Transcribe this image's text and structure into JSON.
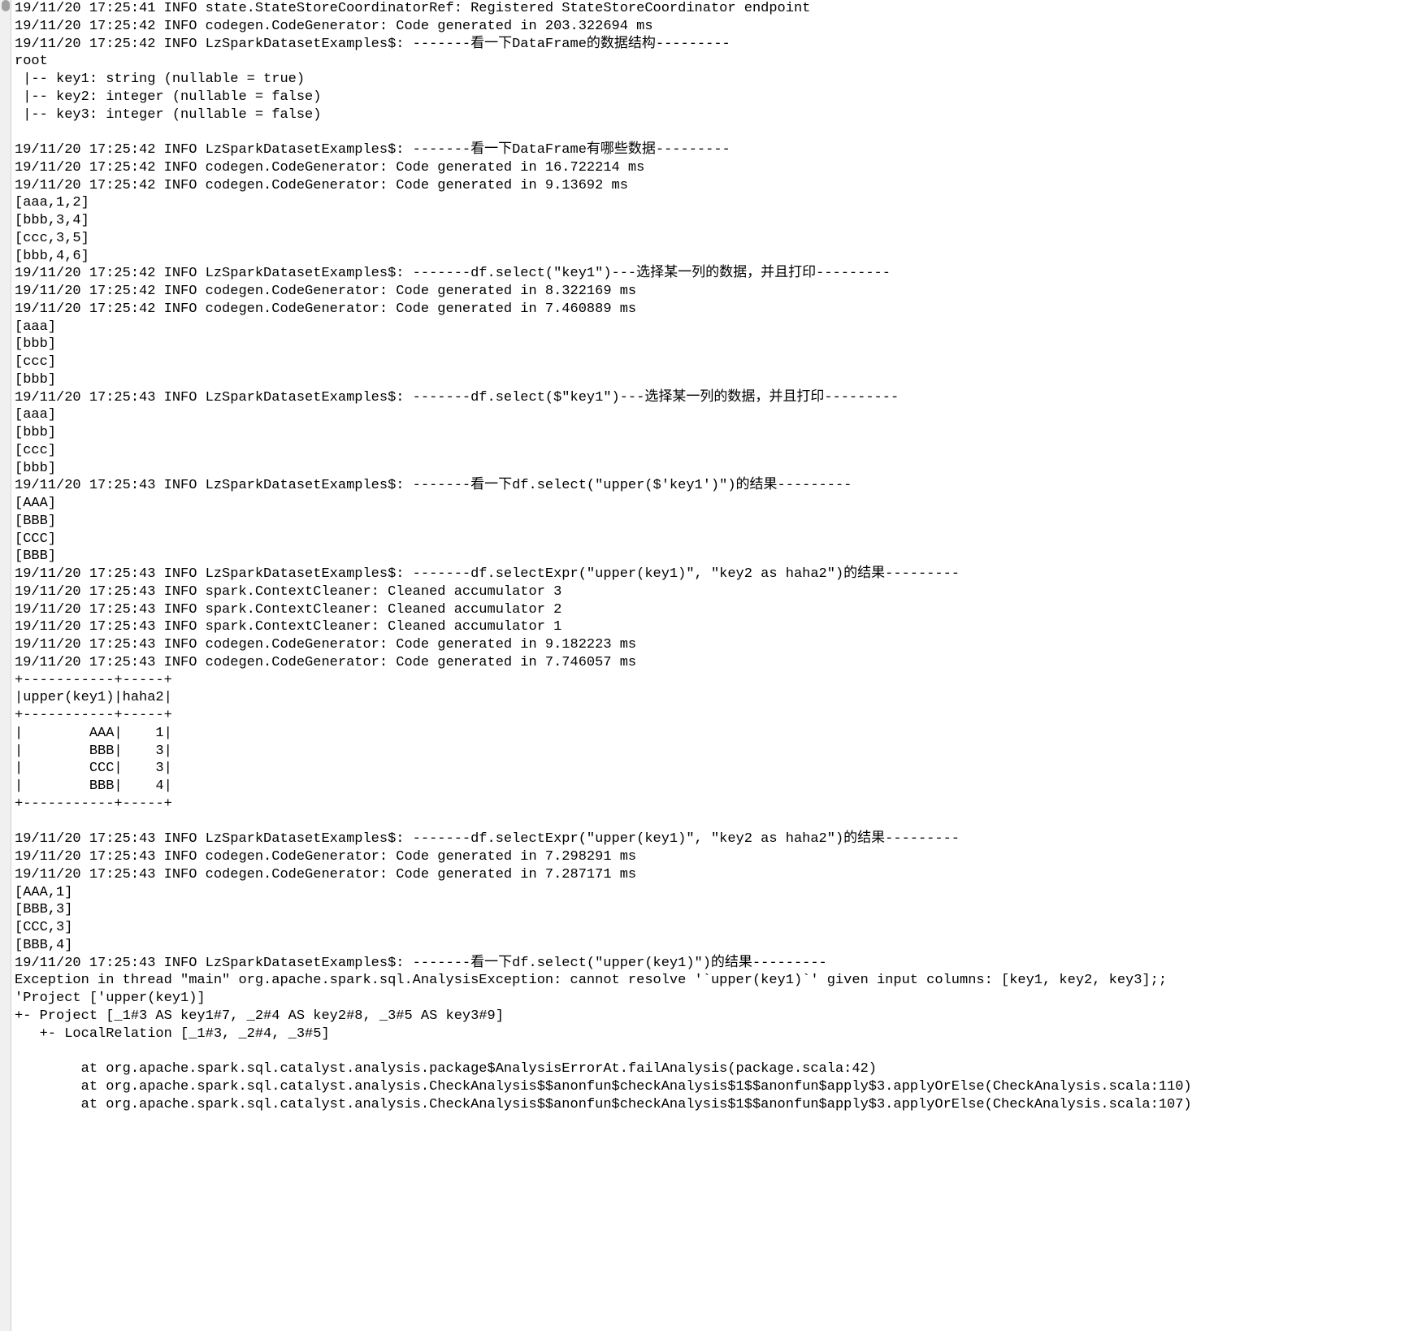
{
  "console": {
    "lines": [
      "19/11/20 17:25:41 INFO state.StateStoreCoordinatorRef: Registered StateStoreCoordinator endpoint",
      "19/11/20 17:25:42 INFO codegen.CodeGenerator: Code generated in 203.322694 ms",
      "19/11/20 17:25:42 INFO LzSparkDatasetExamples$: -------看一下DataFrame的数据结构---------",
      "root",
      " |-- key1: string (nullable = true)",
      " |-- key2: integer (nullable = false)",
      " |-- key3: integer (nullable = false)",
      "",
      "19/11/20 17:25:42 INFO LzSparkDatasetExamples$: -------看一下DataFrame有哪些数据---------",
      "19/11/20 17:25:42 INFO codegen.CodeGenerator: Code generated in 16.722214 ms",
      "19/11/20 17:25:42 INFO codegen.CodeGenerator: Code generated in 9.13692 ms",
      "[aaa,1,2]",
      "[bbb,3,4]",
      "[ccc,3,5]",
      "[bbb,4,6]",
      "19/11/20 17:25:42 INFO LzSparkDatasetExamples$: -------df.select(\"key1\")---选择某一列的数据，并且打印---------",
      "19/11/20 17:25:42 INFO codegen.CodeGenerator: Code generated in 8.322169 ms",
      "19/11/20 17:25:42 INFO codegen.CodeGenerator: Code generated in 7.460889 ms",
      "[aaa]",
      "[bbb]",
      "[ccc]",
      "[bbb]",
      "19/11/20 17:25:43 INFO LzSparkDatasetExamples$: -------df.select($\"key1\")---选择某一列的数据，并且打印---------",
      "[aaa]",
      "[bbb]",
      "[ccc]",
      "[bbb]",
      "19/11/20 17:25:43 INFO LzSparkDatasetExamples$: -------看一下df.select(\"upper($'key1')\")的结果---------",
      "[AAA]",
      "[BBB]",
      "[CCC]",
      "[BBB]",
      "19/11/20 17:25:43 INFO LzSparkDatasetExamples$: -------df.selectExpr(\"upper(key1)\", \"key2 as haha2\")的结果---------",
      "19/11/20 17:25:43 INFO spark.ContextCleaner: Cleaned accumulator 3",
      "19/11/20 17:25:43 INFO spark.ContextCleaner: Cleaned accumulator 2",
      "19/11/20 17:25:43 INFO spark.ContextCleaner: Cleaned accumulator 1",
      "19/11/20 17:25:43 INFO codegen.CodeGenerator: Code generated in 9.182223 ms",
      "19/11/20 17:25:43 INFO codegen.CodeGenerator: Code generated in 7.746057 ms",
      "+-----------+-----+",
      "|upper(key1)|haha2|",
      "+-----------+-----+",
      "|        AAA|    1|",
      "|        BBB|    3|",
      "|        CCC|    3|",
      "|        BBB|    4|",
      "+-----------+-----+",
      "",
      "19/11/20 17:25:43 INFO LzSparkDatasetExamples$: -------df.selectExpr(\"upper(key1)\", \"key2 as haha2\")的结果---------",
      "19/11/20 17:25:43 INFO codegen.CodeGenerator: Code generated in 7.298291 ms",
      "19/11/20 17:25:43 INFO codegen.CodeGenerator: Code generated in 7.287171 ms",
      "[AAA,1]",
      "[BBB,3]",
      "[CCC,3]",
      "[BBB,4]",
      "19/11/20 17:25:43 INFO LzSparkDatasetExamples$: -------看一下df.select(\"upper(key1)\")的结果---------",
      "Exception in thread \"main\" org.apache.spark.sql.AnalysisException: cannot resolve '`upper(key1)`' given input columns: [key1, key2, key3];;",
      "'Project ['upper(key1)]",
      "+- Project [_1#3 AS key1#7, _2#4 AS key2#8, _3#5 AS key3#9]",
      "   +- LocalRelation [_1#3, _2#4, _3#5]",
      "",
      "        at org.apache.spark.sql.catalyst.analysis.package$AnalysisErrorAt.failAnalysis(package.scala:42)",
      "        at org.apache.spark.sql.catalyst.analysis.CheckAnalysis$$anonfun$checkAnalysis$1$$anonfun$apply$3.applyOrElse(CheckAnalysis.scala:110)",
      "        at org.apache.spark.sql.catalyst.analysis.CheckAnalysis$$anonfun$checkAnalysis$1$$anonfun$apply$3.applyOrElse(CheckAnalysis.scala:107)"
    ]
  }
}
